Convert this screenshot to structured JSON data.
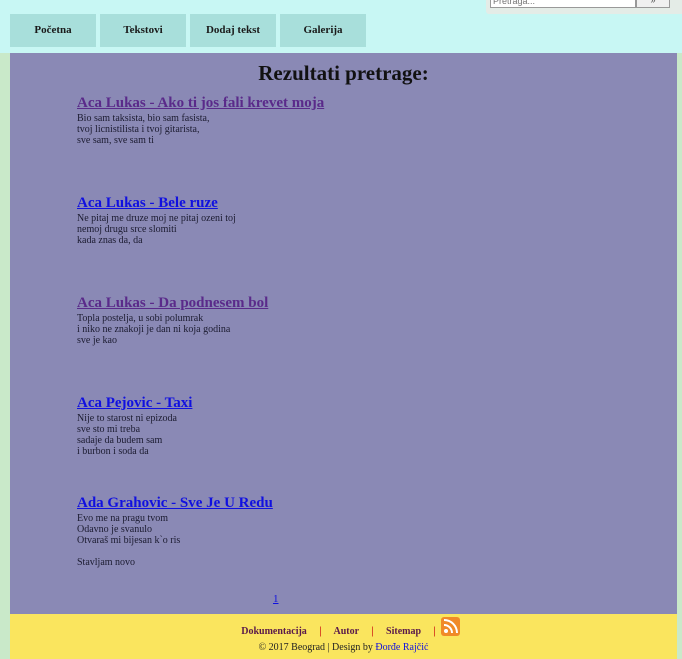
{
  "search": {
    "placeholder": "Pretraga...",
    "button_label": "»"
  },
  "nav": {
    "items": [
      {
        "label": "Početna"
      },
      {
        "label": "Tekstovi"
      },
      {
        "label": "Dodaj tekst"
      },
      {
        "label": "Galerija"
      }
    ]
  },
  "main": {
    "title": "Rezultati pretrage:",
    "results": [
      {
        "title": "Aca Lukas - Ako ti jos fali krevet moja",
        "visited": true,
        "lines": [
          "Bio sam taksista, bio sam fasista,",
          "tvoj licnistilista i tvoj gitarista,",
          "sve sam, sve sam ti"
        ]
      },
      {
        "title": "Aca Lukas - Bele ruze",
        "visited": false,
        "lines": [
          "Ne pitaj me druze moj ne pitaj ozeni toj",
          "nemoj drugu srce slomiti",
          "kada znas da, da"
        ]
      },
      {
        "title": "Aca Lukas - Da podnesem bol",
        "visited": true,
        "lines": [
          "Topla postelja, u sobi polumrak",
          "i niko ne znakoji je dan ni koja godina",
          "sve je kao"
        ]
      },
      {
        "title": "Aca Pejovic - Taxi",
        "visited": false,
        "lines": [
          "Nije to starost ni epizoda",
          "sve sto mi treba",
          "sadaje da budem sam",
          "i burbon i soda da"
        ]
      },
      {
        "title": "Ada Grahovic - Sve Je U Redu",
        "visited": false,
        "lines": [
          "Evo me na pragu tvom",
          "Odavno je svanulo",
          "Otvaraš mi bijesan k`o ris",
          "",
          "Stavljam novo"
        ]
      }
    ],
    "pager": "1"
  },
  "footer": {
    "links": [
      {
        "label": "Dokumentacija"
      },
      {
        "label": "Autor"
      },
      {
        "label": "Sitemap"
      }
    ],
    "separator": "|",
    "copyright_prefix": "© 2017 Beograd | Design by ",
    "author": "Đorđe Rajčić"
  },
  "colors": {
    "header_bg": "#c8f7f4",
    "nav_bg": "#a8dfdb",
    "main_bg": "#8a89b5",
    "footer_bg": "#fae55e",
    "link": "#1010e0",
    "link_visited": "#5a2a8a",
    "rss": "#f08a28"
  }
}
